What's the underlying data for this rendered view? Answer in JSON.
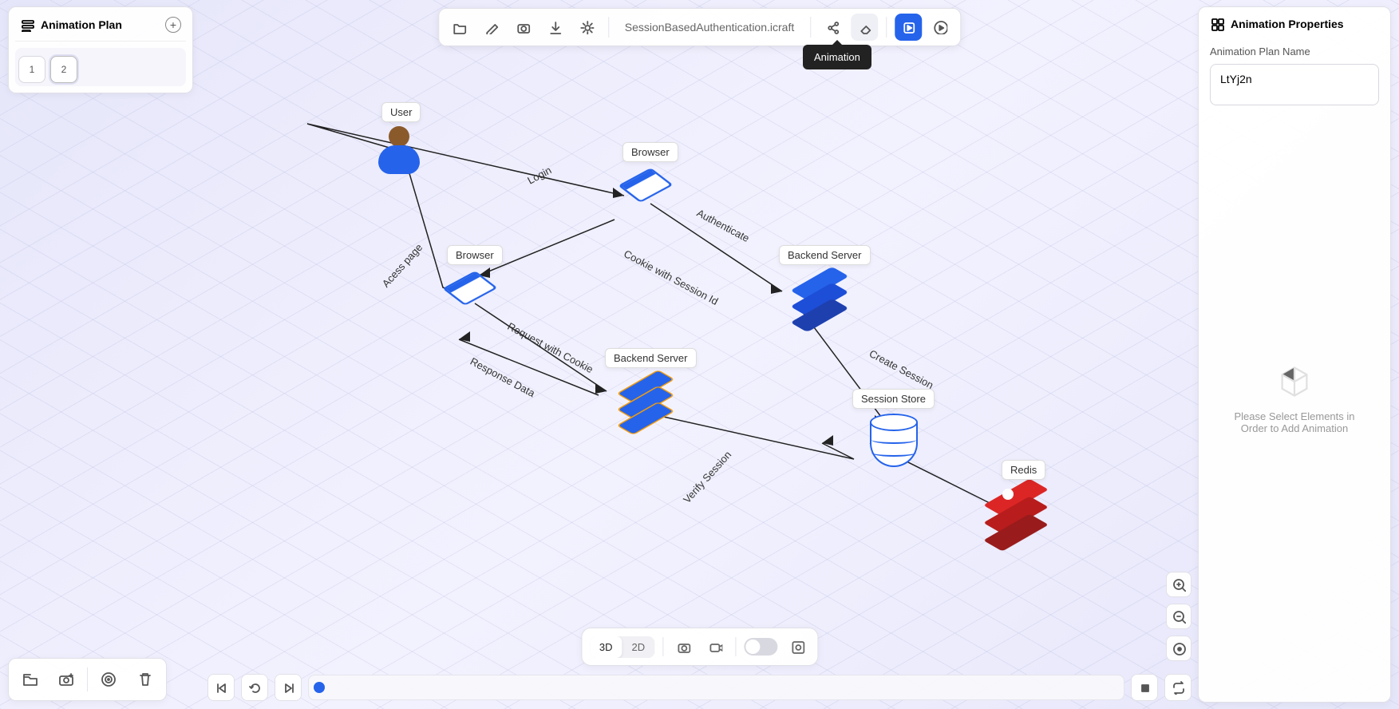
{
  "left_panel": {
    "title": "Animation Plan",
    "items": [
      "1",
      "2"
    ]
  },
  "toolbar": {
    "filename": "SessionBasedAuthentication.icraft",
    "tooltip_animation": "Animation"
  },
  "right_panel": {
    "title": "Animation Properties",
    "field_label": "Animation Plan Name",
    "field_value": "LtYj2n",
    "empty_text": "Please Select Elements in Order to Add Animation"
  },
  "view": {
    "mode_3d": "3D",
    "mode_2d": "2D"
  },
  "diagram": {
    "nodes": {
      "user": "User",
      "browser1": "Browser",
      "browser2": "Browser",
      "backend1": "Backend Server",
      "backend2": "Backend Server",
      "session_store": "Session Store",
      "redis": "Redis"
    },
    "edges": {
      "login": "Login",
      "access_page": "Acess page",
      "authenticate": "Authenticate",
      "cookie_session": "Cookie with Session Id",
      "request_cookie": "Request with Cookie",
      "response_data": "Response Data",
      "create_session": "Create Session",
      "verify_session": "Verify Session"
    }
  },
  "colors": {
    "accent": "#2563eb",
    "danger": "#dc2626"
  }
}
